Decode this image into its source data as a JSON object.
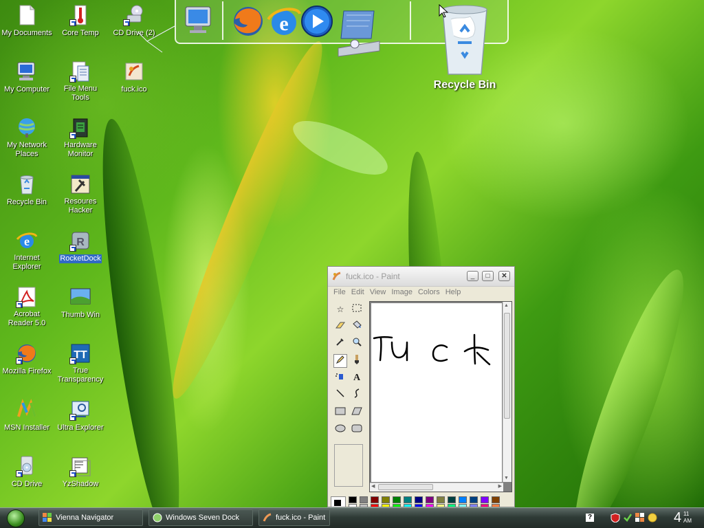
{
  "desktop": {
    "icons": [
      {
        "label": "My Documents",
        "icon": "my-documents-icon"
      },
      {
        "label": "Core Temp",
        "icon": "thermometer-icon"
      },
      {
        "label": "CD Drive (2)",
        "icon": "cd-drive-icon"
      },
      {
        "label": "My Computer",
        "icon": "my-computer-icon"
      },
      {
        "label": "File Menu Tools",
        "icon": "file-menu-tools-icon"
      },
      {
        "label": "fuck.ico",
        "icon": "ico-file-icon"
      },
      {
        "label": "My Network Places",
        "icon": "network-places-icon"
      },
      {
        "label": "Hardware Monitor",
        "icon": "hardware-monitor-icon"
      },
      {
        "label": "Recycle Bin",
        "icon": "recycle-bin-icon"
      },
      {
        "label": "Resoures Hacker",
        "icon": "resource-hacker-icon"
      },
      {
        "label": "Internet Explorer",
        "icon": "internet-explorer-icon"
      },
      {
        "label": "RocketDock",
        "icon": "rocketdock-icon"
      },
      {
        "label": "Acrobat Reader 5.0",
        "icon": "acrobat-icon"
      },
      {
        "label": "Thumb Win",
        "icon": "thumb-win-icon"
      },
      {
        "label": "Mozilla Firefox",
        "icon": "firefox-icon"
      },
      {
        "label": "True Transparency",
        "icon": "true-transparency-icon"
      },
      {
        "label": "MSN Installer",
        "icon": "msn-icon"
      },
      {
        "label": "Ultra Explorer",
        "icon": "ultra-explorer-icon"
      },
      {
        "label": "CD Drive",
        "icon": "cd-drive-icon"
      },
      {
        "label": "YzShadow",
        "icon": "yzshadow-icon"
      }
    ],
    "recycle_bin_big_label": "Recycle Bin"
  },
  "dock": {
    "items": [
      "monitor-icon",
      "firefox-icon",
      "internet-explorer-icon",
      "media-player-icon",
      "control-panel-icon"
    ]
  },
  "paint": {
    "title": "fuck.ico - Paint",
    "menu": [
      "File",
      "Edit",
      "View",
      "Image",
      "Colors",
      "Help"
    ],
    "canvas_text": "FUCK",
    "palette": [
      "#000000",
      "#808080",
      "#800000",
      "#808000",
      "#008000",
      "#008080",
      "#000080",
      "#800080",
      "#808040",
      "#004040",
      "#0080ff",
      "#004080",
      "#8000ff",
      "#804000",
      "#ffffff",
      "#c0c0c0",
      "#ff0000",
      "#ffff00",
      "#00ff00",
      "#00ffff",
      "#0000ff",
      "#ff00ff",
      "#ffff80",
      "#00ff80",
      "#80ffff",
      "#8080ff",
      "#ff0080",
      "#ff8040"
    ]
  },
  "taskbar": {
    "tasks": [
      {
        "label": "Vienna Navigator"
      },
      {
        "label": "Windows Seven Dock"
      },
      {
        "label": "fuck.ico - Paint"
      }
    ],
    "clock_hour": "4",
    "clock_min": "11",
    "clock_ampm": "AM"
  }
}
